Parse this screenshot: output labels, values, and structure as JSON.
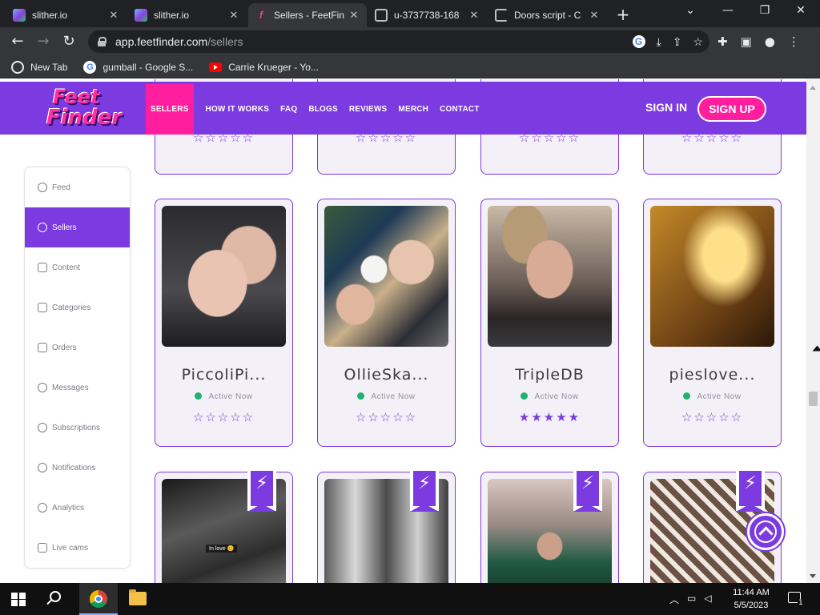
{
  "browser": {
    "tabs": [
      {
        "title": "slither.io",
        "icon": "slither-favicon",
        "active": false
      },
      {
        "title": "slither.io",
        "icon": "slither-favicon",
        "active": false
      },
      {
        "title": "Sellers - FeetFin",
        "icon": "feetfinder-favicon",
        "active": true
      },
      {
        "title": "u-3737738-168",
        "icon": "globe-icon",
        "active": false
      },
      {
        "title": "Doors script - C",
        "icon": "loading-icon",
        "active": false
      }
    ],
    "url_host": "app.feetfinder.com",
    "url_path": "/sellers",
    "bookmarks": [
      {
        "label": "New Tab",
        "icon": "globe-icon"
      },
      {
        "label": "gumball - Google S...",
        "icon": "google-icon"
      },
      {
        "label": "Carrie Krueger - Yo...",
        "icon": "youtube-icon"
      }
    ]
  },
  "site": {
    "logo_line1": "Feet",
    "logo_line2": "Finder",
    "nav": [
      "SELLERS",
      "HOW IT WORKS",
      "FAQ",
      "BLOGS",
      "REVIEWS",
      "MERCH",
      "CONTACT"
    ],
    "sign_in": "SIGN IN",
    "sign_up": "SIGN UP",
    "accent": "#7b3be0",
    "pink": "#ff1f9e"
  },
  "sidebar": {
    "items": [
      {
        "label": "Feed",
        "icon": "compass-icon"
      },
      {
        "label": "Sellers",
        "icon": "user-icon",
        "active": true
      },
      {
        "label": "Content",
        "icon": "document-icon"
      },
      {
        "label": "Categories",
        "icon": "grid-icon"
      },
      {
        "label": "Orders",
        "icon": "cart-icon"
      },
      {
        "label": "Messages",
        "icon": "chat-icon"
      },
      {
        "label": "Subscriptions",
        "icon": "dollar-icon"
      },
      {
        "label": "Notifications",
        "icon": "bell-icon"
      },
      {
        "label": "Analytics",
        "icon": "chart-icon"
      },
      {
        "label": "Live cams",
        "icon": "camera-icon"
      }
    ]
  },
  "top_row_ratings": [
    "☆☆☆☆☆",
    "☆☆☆☆☆",
    "☆☆☆☆☆",
    "☆☆☆☆☆"
  ],
  "sellers": [
    {
      "name": "PiccoliPi...",
      "status": "Active Now",
      "rating_stars": 0,
      "stars": "☆☆☆☆☆"
    },
    {
      "name": "OllieSka...",
      "status": "Active Now",
      "rating_stars": 0,
      "stars": "☆☆☆☆☆"
    },
    {
      "name": "TripleDB",
      "status": "Active Now",
      "rating_stars": 5,
      "stars": "★★★★★"
    },
    {
      "name": "pieslove...",
      "status": "Active Now",
      "rating_stars": 0,
      "stars": "☆☆☆☆☆"
    }
  ],
  "bottom_row": {
    "badge_icon": "lightning-icon",
    "badge_glyph": "⚡",
    "caption": "In love 😊"
  },
  "taskbar": {
    "time": "11:44 AM",
    "date": "5/5/2023",
    "notification_count": "1"
  }
}
